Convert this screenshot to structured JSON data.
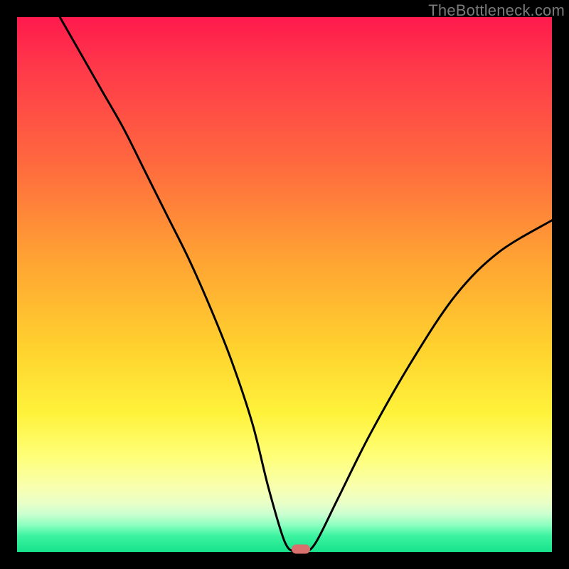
{
  "watermark": "TheBottleneck.com",
  "chart_data": {
    "type": "line",
    "title": "",
    "xlabel": "",
    "ylabel": "",
    "xlim": [
      0,
      100
    ],
    "ylim": [
      0,
      100
    ],
    "series": [
      {
        "name": "bottleneck-curve",
        "x": [
          8,
          12,
          16,
          20,
          24,
          28,
          32,
          36,
          40,
          44,
          47,
          50,
          52,
          54,
          56,
          60,
          66,
          74,
          82,
          90,
          100
        ],
        "values": [
          100,
          93,
          86,
          79,
          71,
          63,
          55,
          46,
          36,
          24,
          12,
          2,
          0,
          0,
          2,
          10,
          22,
          36,
          48,
          56,
          62
        ]
      }
    ],
    "marker": {
      "x": 53,
      "y": 0
    },
    "background_gradient": {
      "stops": [
        {
          "pos": 0,
          "color": "#ff1a4d"
        },
        {
          "pos": 45,
          "color": "#ffa233"
        },
        {
          "pos": 74,
          "color": "#fff23b"
        },
        {
          "pos": 100,
          "color": "#17e28c"
        }
      ]
    }
  }
}
